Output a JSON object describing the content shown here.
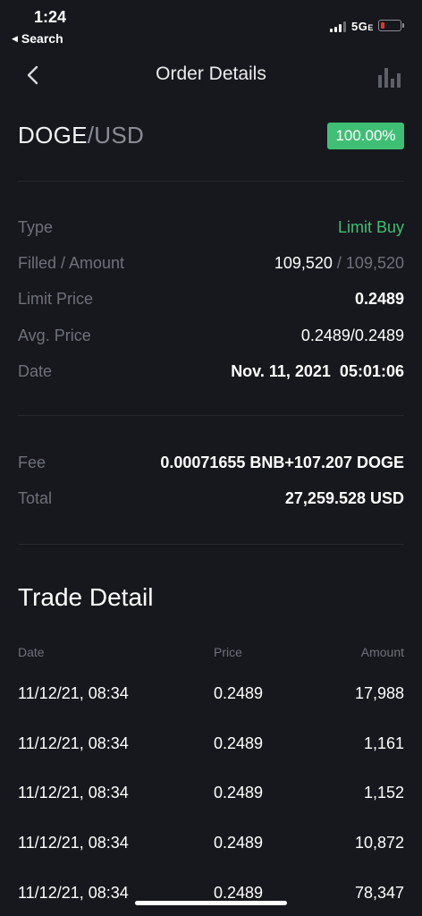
{
  "status_bar": {
    "time": "1:24",
    "back_label": "Search",
    "network": "5G",
    "network_suffix": "E"
  },
  "nav": {
    "title": "Order Details"
  },
  "pair": {
    "base": "DOGE",
    "separator": "/",
    "quote": "USD",
    "filled_percent": "100.00%"
  },
  "details": {
    "type_label": "Type",
    "type_value": "Limit Buy",
    "filled_label": "Filled / Amount",
    "filled_value": "109,520",
    "filled_sep": " / ",
    "amount_value": "109,520",
    "limit_price_label": "Limit Price",
    "limit_price_value": "0.2489",
    "avg_price_label": "Avg. Price",
    "avg_price_value": "0.2489/0.2489",
    "date_label": "Date",
    "date_value": "Nov. 11, 2021  05:01:06"
  },
  "fees": {
    "fee_label": "Fee",
    "fee_value": "0.00071655 BNB+107.207 DOGE",
    "total_label": "Total",
    "total_value": "27,259.528 USD"
  },
  "trade_detail": {
    "title": "Trade Detail",
    "columns": {
      "date": "Date",
      "price": "Price",
      "amount": "Amount"
    },
    "rows": [
      {
        "date": "11/12/21, 08:34",
        "price": "0.2489",
        "amount": "17,988"
      },
      {
        "date": "11/12/21, 08:34",
        "price": "0.2489",
        "amount": "1,161"
      },
      {
        "date": "11/12/21, 08:34",
        "price": "0.2489",
        "amount": "1,152"
      },
      {
        "date": "11/12/21, 08:34",
        "price": "0.2489",
        "amount": "10,872"
      },
      {
        "date": "11/12/21, 08:34",
        "price": "0.2489",
        "amount": "78,347"
      }
    ]
  },
  "colors": {
    "background": "#17181d",
    "accent_green": "#3fbf75",
    "muted_text": "#6e717b"
  },
  "icons": [
    "signal-icon",
    "battery-icon",
    "back-chevron-icon",
    "chart-bars-icon"
  ]
}
